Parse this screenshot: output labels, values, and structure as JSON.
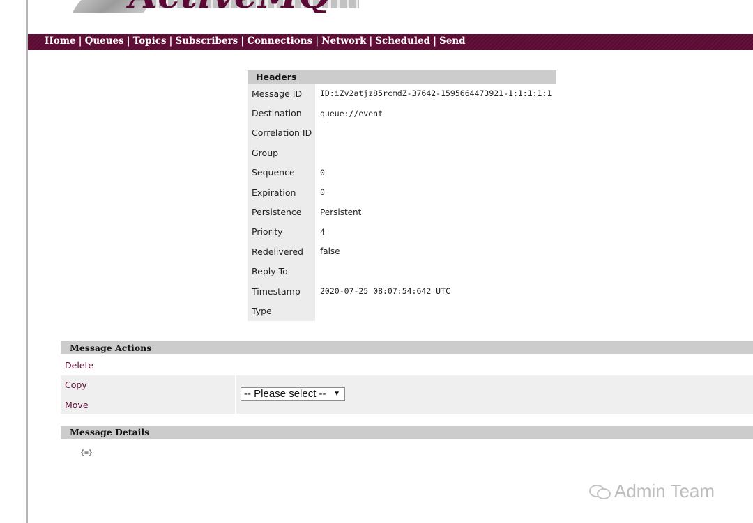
{
  "logo": {
    "text": "ActiveMQ"
  },
  "nav": {
    "items": [
      "Home",
      "Queues",
      "Topics",
      "Subscribers",
      "Connections",
      "Network",
      "Scheduled",
      "Send"
    ],
    "separator": "|"
  },
  "headers": {
    "title": "Headers",
    "rows": [
      {
        "label": "Message ID",
        "value": "ID:iZv2atjz85rcmdZ-37642-1595664473921-1:1:1:1:1"
      },
      {
        "label": "Destination",
        "value": "queue://event"
      },
      {
        "label": "Correlation ID",
        "value": ""
      },
      {
        "label": "Group",
        "value": ""
      },
      {
        "label": "Sequence",
        "value": "0"
      },
      {
        "label": "Expiration",
        "value": "0"
      },
      {
        "label": "Persistence",
        "value": "Persistent"
      },
      {
        "label": "Priority",
        "value": "4"
      },
      {
        "label": "Redelivered",
        "value": "false"
      },
      {
        "label": "Reply To",
        "value": ""
      },
      {
        "label": "Timestamp",
        "value": "2020-07-25 08:07:54:642 UTC"
      },
      {
        "label": "Type",
        "value": ""
      }
    ]
  },
  "actions": {
    "title": "Message Actions",
    "delete_label": "Delete",
    "copy_label": "Copy",
    "move_label": "Move",
    "select_value": "-- Please select --"
  },
  "details": {
    "title": "Message Details",
    "body": "{=}"
  },
  "watermark": {
    "text": "Admin Team"
  },
  "colors": {
    "brand": "#5c0a35",
    "header_gray": "#cccccc",
    "label_gray": "#ececec"
  }
}
